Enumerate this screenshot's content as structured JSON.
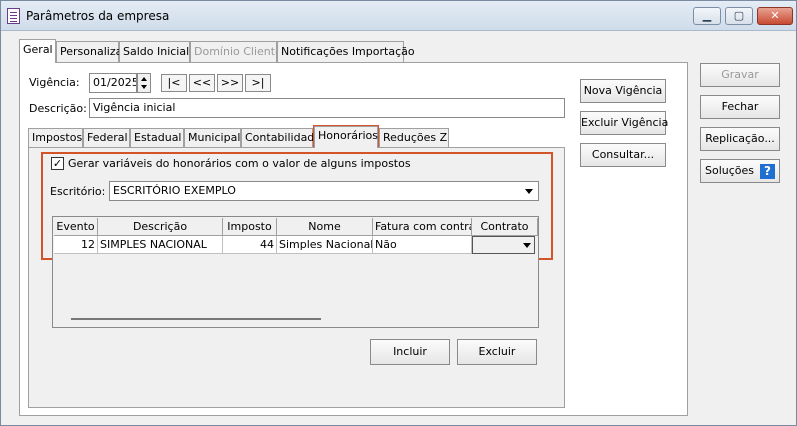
{
  "window": {
    "title": "Parâmetros da empresa",
    "min": "▁",
    "max": "▢",
    "close": "✕"
  },
  "tabs": [
    {
      "label": "Geral"
    },
    {
      "label": "Personaliza"
    },
    {
      "label": "Saldo Inicial"
    },
    {
      "label": "Domínio Cliente"
    },
    {
      "label": "Notificações Importação"
    }
  ],
  "vigencia": {
    "label": "Vigência:",
    "value": "01/2025"
  },
  "nav": {
    "first": "|<",
    "prev": "<<",
    "next": ">>",
    "last": ">|"
  },
  "descricao": {
    "label": "Descrição:",
    "value": "Vigência inicial"
  },
  "side_buttons": {
    "nova_vigencia": "Nova Vigência",
    "excluir_vigencia": "Excluir Vigência",
    "consultar": "Consultar..."
  },
  "right_buttons": {
    "gravar": "Gravar",
    "fechar": "Fechar",
    "replicacao": "Replicação...",
    "solucoes": "Soluções",
    "help": "?"
  },
  "subtabs": [
    {
      "label": "Impostos"
    },
    {
      "label": "Federal"
    },
    {
      "label": "Estadual"
    },
    {
      "label": "Municipal"
    },
    {
      "label": "Contabilidade"
    },
    {
      "label": "Honorários"
    },
    {
      "label": "Reduções Z"
    }
  ],
  "honorarios": {
    "checkbox_label": "Gerar variáveis do honorários com o valor de alguns impostos",
    "check_mark": "✓",
    "escritorio_label": "Escritório:",
    "escritorio_value": "ESCRITÓRIO EXEMPLO",
    "grid": {
      "headers": [
        "Evento",
        "Descrição",
        "Imposto",
        "Nome",
        "Fatura com contrato",
        "Contrato"
      ],
      "rows": [
        {
          "evento": "12",
          "descricao": "SIMPLES NACIONAL",
          "imposto": "44",
          "nome": "Simples Nacional",
          "fatura": "Não",
          "contrato": ""
        }
      ]
    },
    "incluir": "Incluir",
    "excluir": "Excluir"
  }
}
